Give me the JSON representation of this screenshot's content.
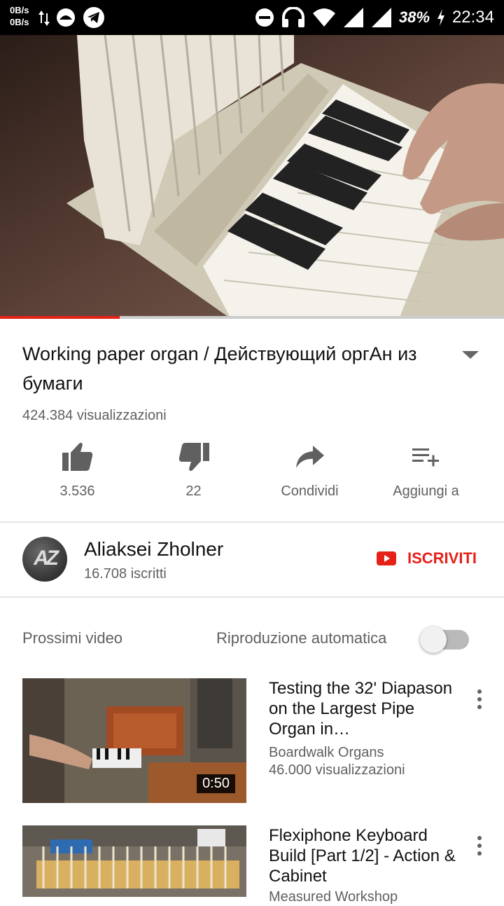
{
  "status_bar": {
    "net_up": "0B/s",
    "net_down": "0B/s",
    "battery_percent": "38%",
    "time": "22:34"
  },
  "player": {
    "progress_fraction": 0.237,
    "progress_color": "#e62117"
  },
  "video": {
    "title": "Working paper organ / Действующий оргАн из бумаги",
    "views": "424.384 visualizzazioni"
  },
  "actions": [
    {
      "icon": "thumb-up-icon",
      "label": "3.536"
    },
    {
      "icon": "thumb-down-icon",
      "label": "22"
    },
    {
      "icon": "share-icon",
      "label": "Condividi"
    },
    {
      "icon": "playlist-add-icon",
      "label": "Aggiungi a"
    }
  ],
  "channel": {
    "avatar_text": "AZ",
    "name": "Aliaksei Zholner",
    "subscribers": "16.708 iscritti",
    "subscribe_label": "ISCRIVITI",
    "accent_color": "#e62117"
  },
  "up_next": {
    "title": "Prossimi video",
    "autoplay_label": "Riproduzione automatica",
    "autoplay_on": false
  },
  "videos": [
    {
      "title": "Testing the 32' Diapason on the Largest Pipe Organ in…",
      "channel": "Boardwalk Organs",
      "views": "46.000 visualizzazioni",
      "duration": "0:50"
    },
    {
      "title": "Flexiphone Keyboard Build [Part 1/2] - Action & Cabinet",
      "channel": "Measured Workshop"
    }
  ]
}
